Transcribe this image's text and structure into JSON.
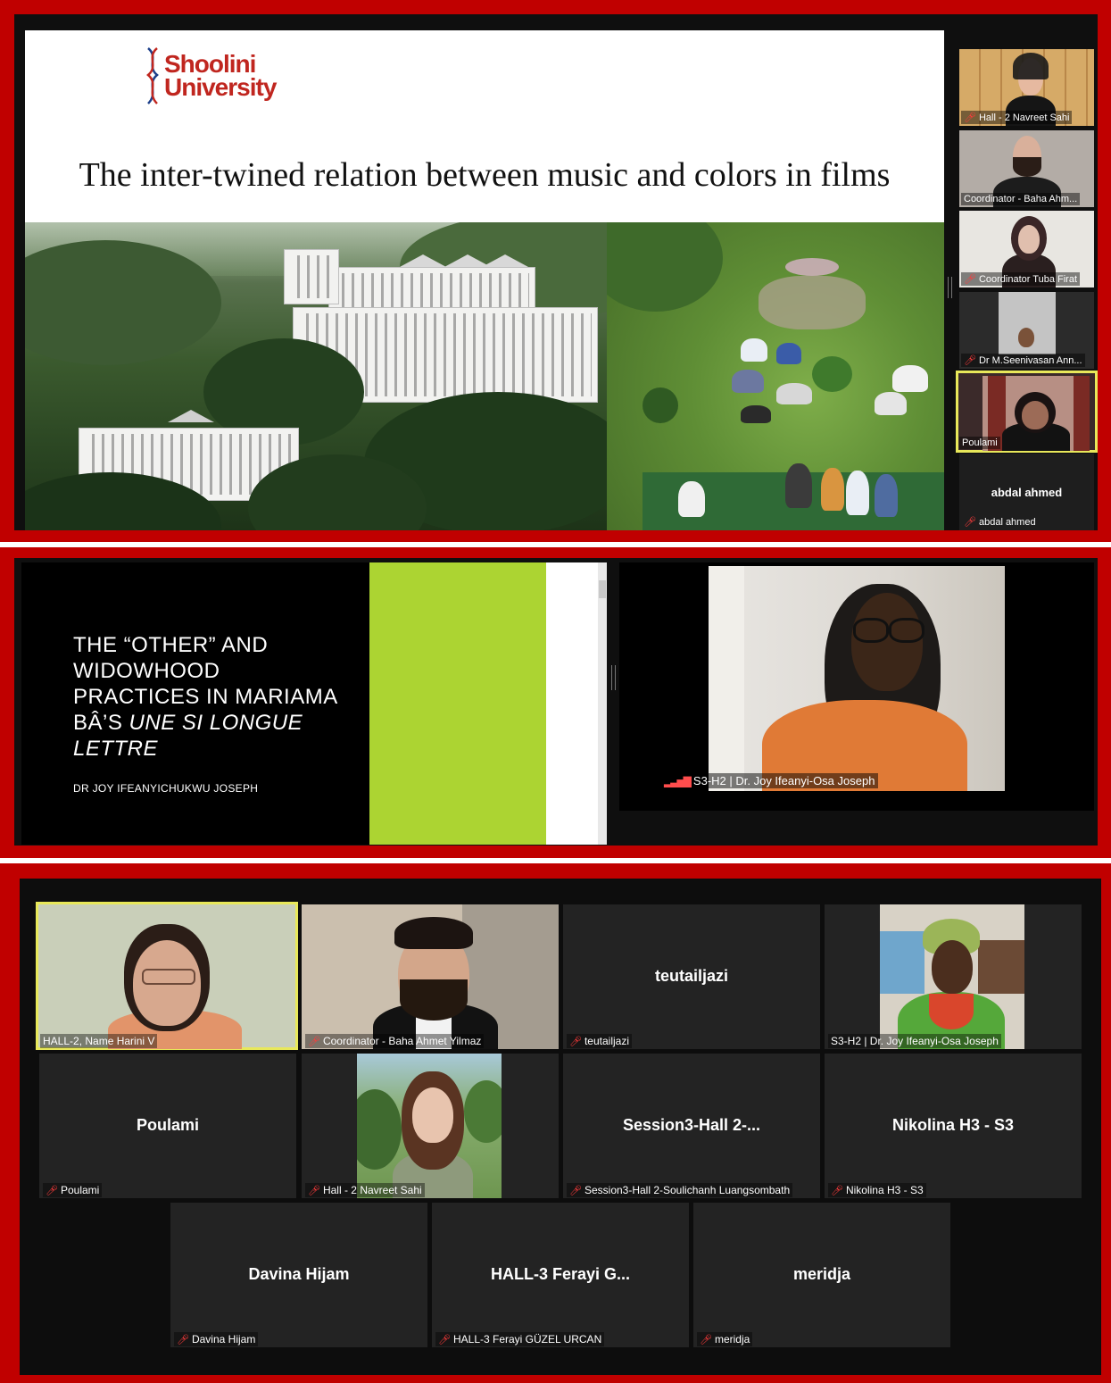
{
  "colors": {
    "frame": "#c00000",
    "active_speaker_outline": "#e8e85a",
    "muted_icon": "#ff3b3b",
    "slide2_green": "#acd432",
    "logo": "#c0261f"
  },
  "panel1": {
    "slide": {
      "logo_line1": "Shoolini",
      "logo_line2": "University",
      "title": "The inter-twined relation between music and colors in films"
    },
    "participants": [
      {
        "label": "Hall - 2 Navreet Sahi",
        "muted": true
      },
      {
        "label": "Coordinator - Baha Ahm...",
        "muted": false
      },
      {
        "label": "Coordinator Tuba Firat",
        "muted": true
      },
      {
        "label": "Dr M.Seenivasan Ann...",
        "muted": true
      },
      {
        "label": "Poulami",
        "muted": false,
        "active": true
      },
      {
        "display_name": "abdal ahmed",
        "label": "abdal ahmed",
        "muted": true
      }
    ]
  },
  "panel2": {
    "slide": {
      "title_line1": "THE “OTHER” AND",
      "title_line2": "WIDOWHOOD",
      "title_line3": "PRACTICES IN MARIAMA",
      "title_line4_prefix": "BÂ’S ",
      "title_line4_italic": "UNE SI LONGUE",
      "title_line5_italic": "LETTRE",
      "author": "DR  JOY IFEANYICHUKWU JOSEPH"
    },
    "speaker_label": "S3-H2 | Dr. Joy Ifeanyi-Osa Joseph",
    "signal_icon": "signal-bars-icon"
  },
  "panel3": {
    "tiles": [
      {
        "label": "HALL-2, Name Harini V",
        "muted": false,
        "active": true
      },
      {
        "label": "Coordinator - Baha Ahmet Yilmaz",
        "muted": true
      },
      {
        "display_name": "teutailjazi",
        "label": "teutailjazi",
        "muted": true
      },
      {
        "label": "S3-H2 | Dr. Joy Ifeanyi-Osa Joseph",
        "muted": false
      },
      {
        "display_name": "Poulami",
        "label": "Poulami",
        "muted": true
      },
      {
        "label": "Hall - 2 Navreet Sahi",
        "muted": true
      },
      {
        "display_name": "Session3-Hall  2-...",
        "label": "Session3-Hall 2-Soulichanh Luangsombath",
        "muted": true
      },
      {
        "display_name": "Nikolina H3 - S3",
        "label": "Nikolina H3 - S3",
        "muted": true
      },
      {
        "display_name": "Davina Hijam",
        "label": "Davina Hijam",
        "muted": true
      },
      {
        "display_name": "HALL-3  Ferayi G...",
        "label": "HALL-3 Ferayi GÜZEL URCAN",
        "muted": true
      },
      {
        "display_name": "meridja",
        "label": "meridja",
        "muted": true
      }
    ]
  }
}
